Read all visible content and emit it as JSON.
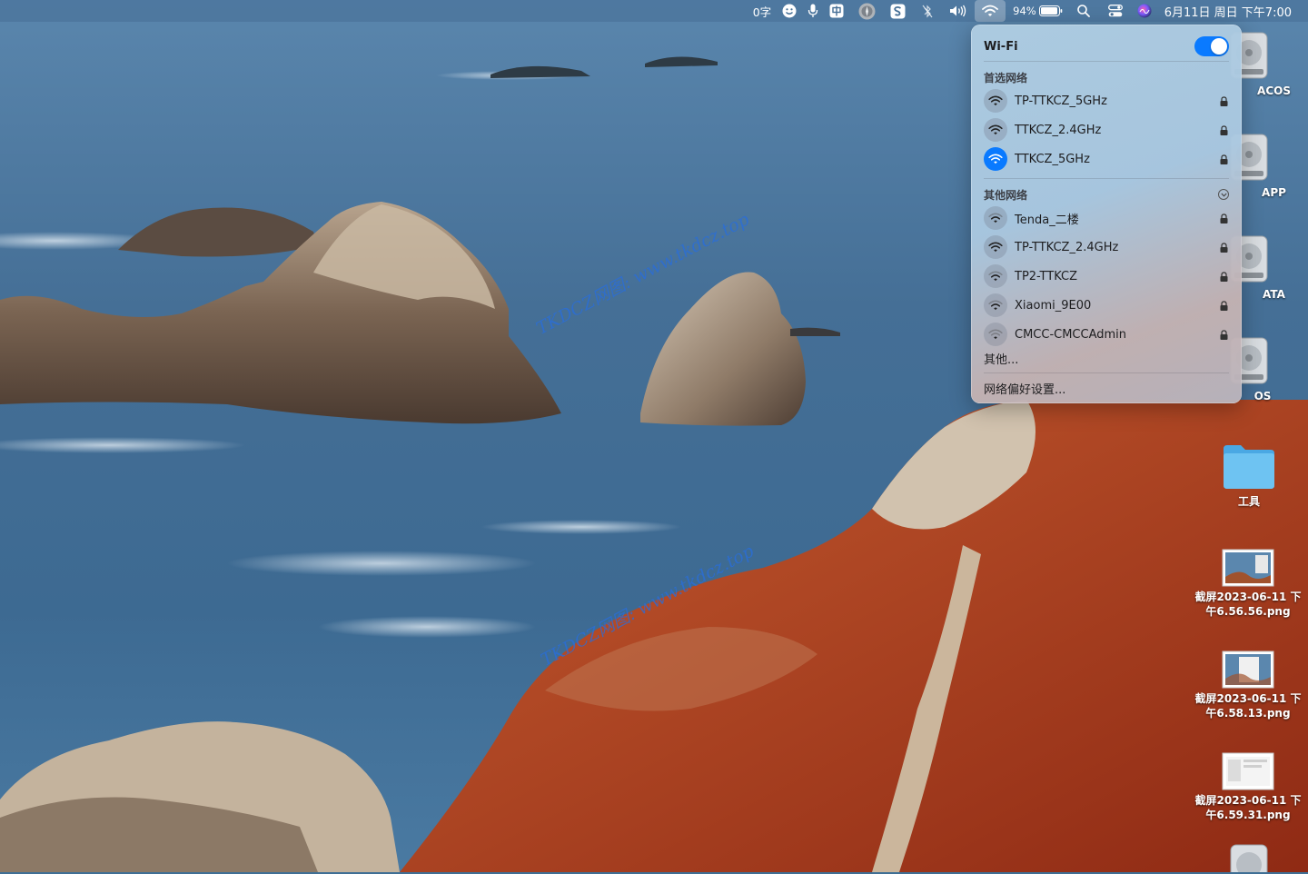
{
  "menubar": {
    "word_count": "0字",
    "battery_percent": "94%",
    "clock": "6月11日 周日 下午7:00",
    "icons": [
      "emoji-icon",
      "microphone-icon",
      "input-method-icon",
      "compass-icon",
      "sogou-icon",
      "bluetooth-off-icon",
      "volume-icon",
      "wifi-icon",
      "battery-icon",
      "spotlight-icon",
      "control-center-icon",
      "siri-icon"
    ]
  },
  "wifi_menu": {
    "title": "Wi-Fi",
    "enabled": true,
    "preferred_label": "首选网络",
    "preferred_networks": [
      {
        "name": "TP-TTKCZ_5GHz",
        "connected": false,
        "locked": true
      },
      {
        "name": "TTKCZ_2.4GHz",
        "connected": false,
        "locked": true
      },
      {
        "name": "TTKCZ_5GHz",
        "connected": true,
        "locked": true
      }
    ],
    "other_label": "其他网络",
    "other_networks": [
      {
        "name": "Tenda_二楼",
        "locked": true
      },
      {
        "name": "TP-TTKCZ_2.4GHz",
        "locked": true
      },
      {
        "name": "TP2-TTKCZ",
        "locked": true
      },
      {
        "name": "Xiaomi_9E00",
        "locked": true
      },
      {
        "name": "CMCC-CMCCAdmin",
        "locked": true
      }
    ],
    "other_link": "其他...",
    "prefs_link": "网络偏好设置...",
    "accent_color": "#0a7aff"
  },
  "desktop": {
    "drives": [
      {
        "label": "ACOS"
      },
      {
        "label": "APP"
      },
      {
        "label": "ATA"
      },
      {
        "label": "OS"
      }
    ],
    "folder": {
      "label": "工具"
    },
    "screenshots": [
      {
        "label": "截屏2023-06-11 下\n午6.56.56.png"
      },
      {
        "label": "截屏2023-06-11 下\n午6.58.13.png"
      },
      {
        "label": "截屏2023-06-11 下\n午6.59.31.png"
      }
    ]
  },
  "watermarks": [
    "TKDCZ网图: www.tkdcz.top",
    "TKDCZ网图: www.tkdcz.top"
  ]
}
